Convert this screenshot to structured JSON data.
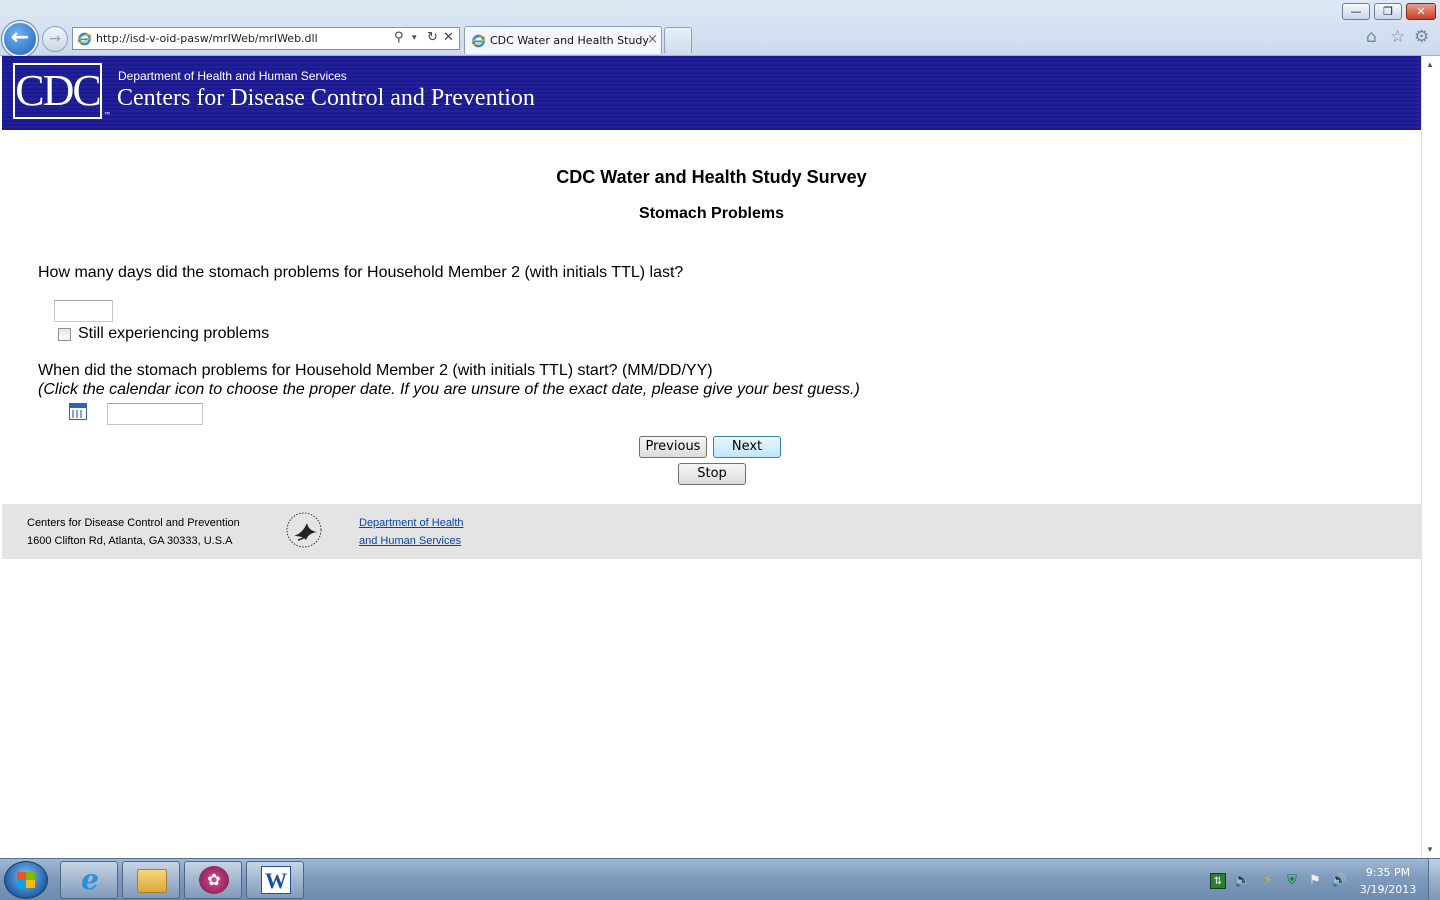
{
  "browser": {
    "url": "http://isd-v-oid-pasw/mrIWeb/mrIWeb.dll",
    "tab_title": "CDC Water and Health Study",
    "tab_close": "×",
    "back_glyph": "←",
    "forward_glyph": "→",
    "window_buttons": {
      "minimize": "—",
      "maximize": "❐",
      "close": "✕"
    },
    "address_tools": {
      "search": "⚲",
      "dropdown": "▾",
      "refresh": "↻",
      "stop": "✕"
    },
    "toolbar_icons": {
      "home": "⌂",
      "favorites": "☆",
      "tools": "⚙"
    },
    "icons": [
      "back-arrow-icon",
      "forward-arrow-icon",
      "ie-icon",
      "search-icon",
      "refresh-icon",
      "stop-icon",
      "home-icon",
      "star-icon",
      "gear-icon"
    ]
  },
  "header": {
    "logo_text": "CDC",
    "logo_mark": "™",
    "department": "Department of Health and Human Services",
    "agency": "Centers for Disease Control and Prevention",
    "background_color": "#1b1a8e"
  },
  "survey": {
    "title": "CDC Water and Health Study Survey",
    "section": "Stomach Problems",
    "q1": {
      "text": "How many days did the stomach problems for Household Member 2 (with initials TTL) last?",
      "value": "",
      "checkbox_label": "Still experiencing problems",
      "checked": false
    },
    "q2": {
      "text": "When did the stomach problems for Household Member 2 (with initials TTL) start? (MM/DD/YY)",
      "instructions": "(Click the calendar icon to choose the proper date. If you are unsure of the exact date, please give your best guess.)",
      "value": ""
    },
    "buttons": {
      "previous": "Previous",
      "next": "Next",
      "stop": "Stop"
    }
  },
  "footer": {
    "org": "Centers for Disease Control and Prevention",
    "address": "1600 Clifton Rd, Atlanta, GA 30333, U.S.A",
    "hhs_link_line1": "Department of Health",
    "hhs_link_line2": "and Human Services"
  },
  "scrollbar": {
    "up": "▲",
    "down": "▼"
  },
  "taskbar": {
    "pinned": [
      "internet-explorer",
      "windows-explorer",
      "media-app",
      "microsoft-word"
    ],
    "glyphs": {
      "ie": "e",
      "app": "✿",
      "word": "W"
    },
    "tray_glyphs": {
      "network": "⇅",
      "volume_muted": "🔈",
      "wand": "⚡",
      "shield": "⛨",
      "flag": "⚑",
      "speaker": "🔊"
    },
    "clock_time": "9:35 PM",
    "clock_date": "3/19/2013"
  }
}
